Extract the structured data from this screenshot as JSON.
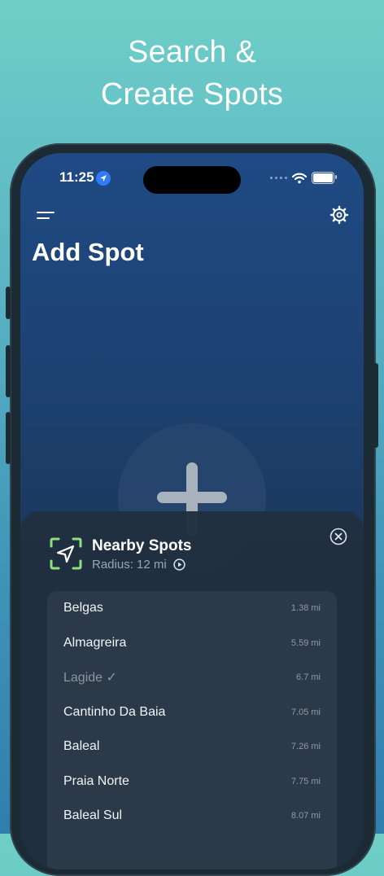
{
  "headline": {
    "line1": "Search &",
    "line2": "Create Spots"
  },
  "status_bar": {
    "time": "11:25"
  },
  "app": {
    "title": "Add Spot"
  },
  "sheet": {
    "title": "Nearby Spots",
    "radius_text": "Radius: 12 mi"
  },
  "spots": [
    {
      "name": "Belgas",
      "distance": "1.38 mi"
    },
    {
      "name": "Almagreira",
      "distance": "5.59 mi"
    },
    {
      "name": "Lagide ✓",
      "distance": "6.7 mi"
    },
    {
      "name": "Cantinho Da Baia",
      "distance": "7.05 mi"
    },
    {
      "name": "Baleal",
      "distance": "7.26 mi"
    },
    {
      "name": "Praia Norte",
      "distance": "7.75 mi"
    },
    {
      "name": "Baleal Sul",
      "distance": "8.07 mi"
    }
  ],
  "colors": {
    "accent_green": "#8fe07a",
    "location_blue": "#2f7cf6"
  }
}
